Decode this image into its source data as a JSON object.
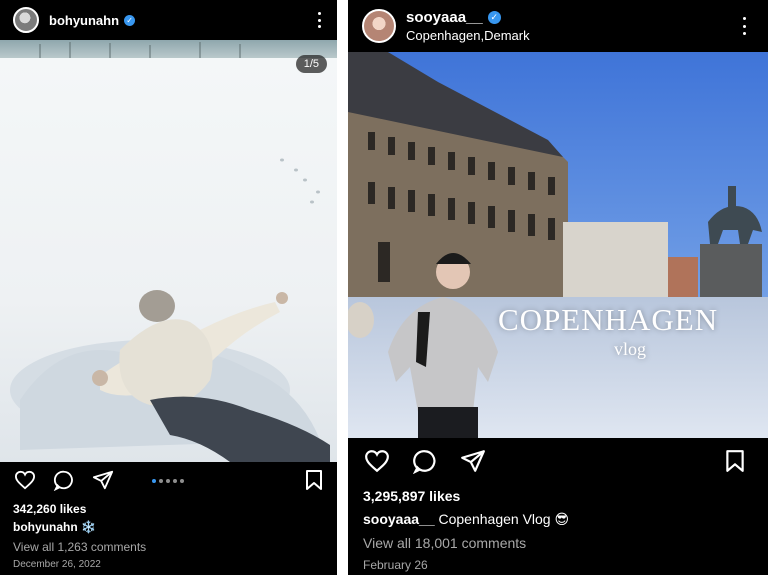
{
  "post_left": {
    "username": "bohyunahn",
    "verified_mark": "✓",
    "carousel_counter": "1/5",
    "carousel_dots": 5,
    "carousel_active_index": 1,
    "likes": "342,260 likes",
    "caption_user": "bohyunahn",
    "caption_text": "❄️",
    "comments": "View all 1,263 comments",
    "date": "December 26, 2022",
    "icons": [
      "heart-icon",
      "comment-icon",
      "share-icon",
      "bookmark-icon",
      "more-icon"
    ]
  },
  "post_right": {
    "username": "sooyaaa__",
    "verified_mark": "✓",
    "location": "Copenhagen,Demark",
    "overlay_title": "COPENHAGEN",
    "overlay_subtitle": "vlog",
    "likes": "3,295,897 likes",
    "caption_user": "sooyaaa__",
    "caption_text": "Copenhagen Vlog 😎",
    "comments": "View all 18,001 comments",
    "date": "February 26",
    "icons": [
      "heart-icon",
      "comment-icon",
      "share-icon",
      "bookmark-icon",
      "more-icon"
    ]
  },
  "colors": {
    "background": "#000000",
    "text": "#ffffff",
    "muted": "#a8a8a8",
    "verified": "#3897f0",
    "carousel_dot_active": "#3897f0",
    "carousel_dot": "#8e8e8e"
  }
}
